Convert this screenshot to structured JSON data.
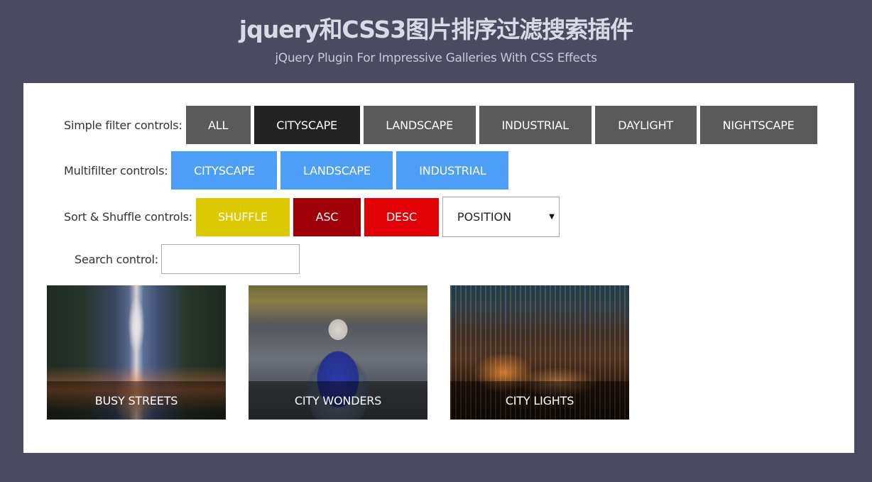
{
  "header": {
    "title": "jquery和CSS3图片排序过滤搜索插件",
    "subtitle": "jQuery Plugin For Impressive Galleries With CSS Effects"
  },
  "simple_filter": {
    "label": "Simple filter controls:",
    "buttons": [
      {
        "label": "ALL",
        "active": false
      },
      {
        "label": "CITYSCAPE",
        "active": true
      },
      {
        "label": "LANDSCAPE",
        "active": false
      },
      {
        "label": "INDUSTRIAL",
        "active": false
      },
      {
        "label": "DAYLIGHT",
        "active": false
      },
      {
        "label": "NIGHTSCAPE",
        "active": false
      }
    ]
  },
  "multi_filter": {
    "label": "Multifilter controls:",
    "buttons": [
      {
        "label": "CITYSCAPE"
      },
      {
        "label": "LANDSCAPE"
      },
      {
        "label": "INDUSTRIAL"
      }
    ]
  },
  "sort_shuffle": {
    "label": "Sort & Shuffle controls:",
    "shuffle_label": "SHUFFLE",
    "asc_label": "ASC",
    "desc_label": "DESC",
    "sort_select_value": "POSITION",
    "select_arrow": "▼"
  },
  "search": {
    "label": "Search control:",
    "value": "",
    "placeholder": ""
  },
  "gallery": {
    "items": [
      {
        "caption": "BUSY STREETS"
      },
      {
        "caption": "CITY WONDERS"
      },
      {
        "caption": "CITY LIGHTS"
      }
    ]
  },
  "colors": {
    "page_bg": "#4a4a60",
    "panel_bg": "#ffffff",
    "filter_button": "#5a5a5a",
    "filter_button_active": "#222222",
    "multifilter_button": "#4d9ef6",
    "shuffle_button": "#ddc900",
    "asc_button": "#a00008",
    "desc_button": "#e00006"
  }
}
